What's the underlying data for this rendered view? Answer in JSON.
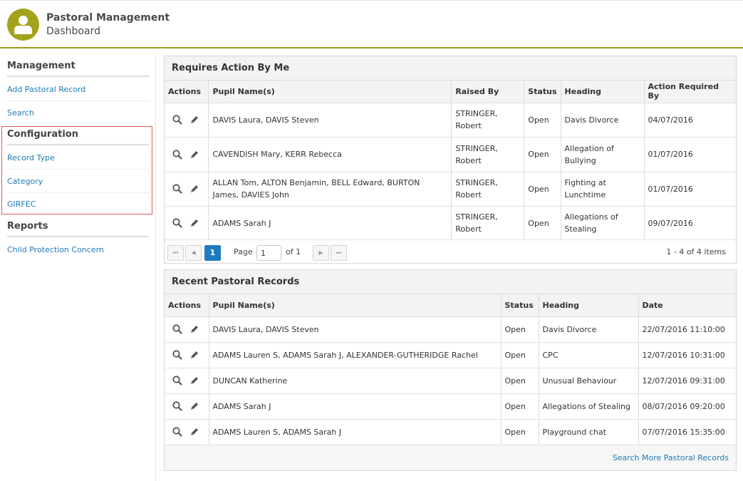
{
  "header": {
    "title": "Pastoral Management",
    "subtitle": "Dashboard"
  },
  "sidebar": {
    "sections": [
      {
        "heading": "Management",
        "items": [
          "Add Pastoral Record",
          "Search"
        ]
      },
      {
        "heading": "Configuration",
        "items": [
          "Record Type",
          "Category",
          "GIRFEC"
        ]
      },
      {
        "heading": "Reports",
        "items": [
          "Child Protection Concern"
        ]
      }
    ]
  },
  "requires_action": {
    "title": "Requires Action By Me",
    "columns": [
      "Actions",
      "Pupil Name(s)",
      "Raised By",
      "Status",
      "Heading",
      "Action Required By"
    ],
    "rows": [
      {
        "pupils": "DAVIS Laura, DAVIS Steven",
        "raised_by": "STRINGER, Robert",
        "status": "Open",
        "heading": "Davis Divorce",
        "date": "04/07/2016"
      },
      {
        "pupils": "CAVENDISH Mary, KERR Rebecca",
        "raised_by": "STRINGER, Robert",
        "status": "Open",
        "heading": "Allegation of Bullying",
        "date": "01/07/2016"
      },
      {
        "pupils": "ALLAN Tom, ALTON Benjamin, BELL Edward, BURTON James, DAVIES John",
        "raised_by": "STRINGER, Robert",
        "status": "Open",
        "heading": "Fighting at Lunchtime",
        "date": "01/07/2016"
      },
      {
        "pupils": "ADAMS Sarah J",
        "raised_by": "STRINGER, Robert",
        "status": "Open",
        "heading": "Allegations of Stealing",
        "date": "09/07/2016"
      }
    ],
    "pager": {
      "first": "⏮",
      "prev": "◀",
      "current_page": "1",
      "page_label": "Page",
      "page_input_value": "1",
      "of_label": "of 1",
      "next": "▶",
      "last": "⏭",
      "info": "1 - 4 of 4 items"
    }
  },
  "recent_records": {
    "title": "Recent Pastoral Records",
    "columns": [
      "Actions",
      "Pupil Name(s)",
      "Status",
      "Heading",
      "Date"
    ],
    "rows": [
      {
        "pupils": "DAVIS Laura, DAVIS Steven",
        "status": "Open",
        "heading": "Davis Divorce",
        "date": "22/07/2016 11:10:00"
      },
      {
        "pupils": "ADAMS Lauren S, ADAMS Sarah J, ALEXANDER-GUTHERIDGE Rachel",
        "status": "Open",
        "heading": "CPC",
        "date": "12/07/2016 10:31:00"
      },
      {
        "pupils": "DUNCAN Katherine",
        "status": "Open",
        "heading": "Unusual Behaviour",
        "date": "12/07/2016 09:31:00"
      },
      {
        "pupils": "ADAMS Sarah J",
        "status": "Open",
        "heading": "Allegations of Stealing",
        "date": "08/07/2016 09:20:00"
      },
      {
        "pupils": "ADAMS Lauren S, ADAMS Sarah J",
        "status": "Open",
        "heading": "Playground chat",
        "date": "07/07/2016 15:35:00"
      }
    ],
    "footer_link": "Search More Pastoral Records"
  },
  "colors": {
    "accent": "#a3a31b",
    "link": "#1f7bb6",
    "pager_active": "#1f7bc0",
    "highlight_border": "#e05a5a"
  }
}
